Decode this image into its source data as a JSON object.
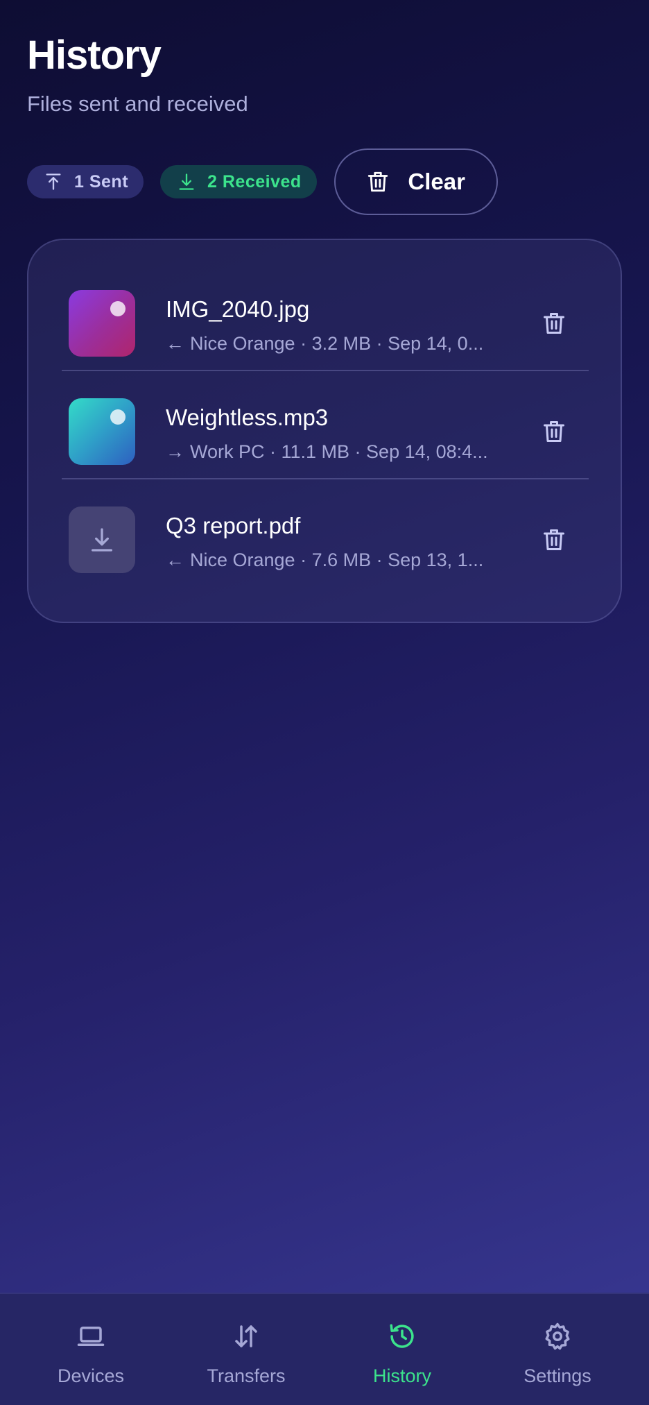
{
  "header": {
    "title": "History",
    "subtitle": "Files sent and received"
  },
  "filters": {
    "sent_label": "1 Sent",
    "received_label": "2 Received",
    "clear_label": "Clear"
  },
  "files": [
    {
      "name": "IMG_2040.jpg",
      "direction_arrow": "←",
      "meta": "Nice Orange · 3.2 MB · Sep 14, 0...",
      "icon": "image-thumbnail"
    },
    {
      "name": "Weightless.mp3",
      "direction_arrow": "→",
      "meta": "Work PC · 11.1 MB · Sep 14, 08:4...",
      "icon": "audio-thumbnail"
    },
    {
      "name": "Q3 report.pdf",
      "direction_arrow": "←",
      "meta": "Nice Orange · 7.6 MB · Sep 13, 1...",
      "icon": "download-icon"
    }
  ],
  "tabs": [
    {
      "label": "Devices",
      "icon": "laptop-icon"
    },
    {
      "label": "Transfers",
      "icon": "transfer-arrows-icon"
    },
    {
      "label": "History",
      "icon": "history-clock-icon",
      "active": true
    },
    {
      "label": "Settings",
      "icon": "gear-icon"
    }
  ],
  "colors": {
    "accent": "#3ce38c",
    "background_top": "#0e0d33",
    "background_bottom": "#3a3a96"
  }
}
